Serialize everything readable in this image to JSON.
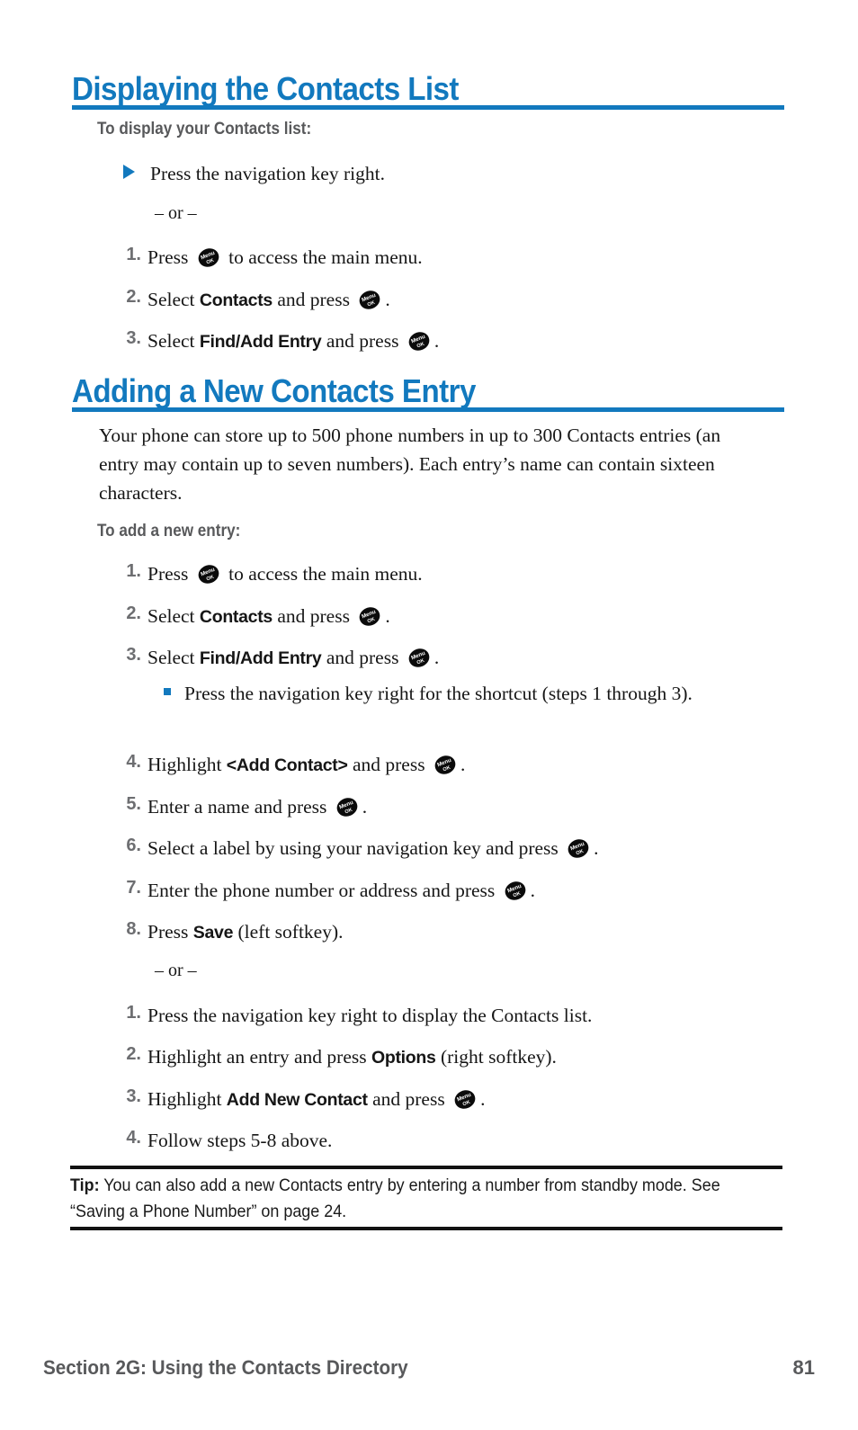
{
  "page": {
    "number": "81",
    "footer_section": "Section 2G: Using the Contacts Directory",
    "accent_color": "#1279be",
    "heading_rule_color": "#1279be",
    "subhead_color": "#58595b"
  },
  "sections": [
    {
      "id": "displaying",
      "heading": "Displaying the Contacts List",
      "subhead": "To display your Contacts list:",
      "bullet": "Press the navigation key right.",
      "or_divider": "– or –",
      "steps": [
        {
          "num": "1.",
          "pre": "Press ",
          "icon": "menu-ok-key-icon",
          "post": " to access the main menu.",
          "bold": ""
        },
        {
          "num": "2.",
          "pre": "Select ",
          "bold": "Contacts",
          "mid": " and press ",
          "icon": "menu-ok-key-icon",
          "post": "."
        },
        {
          "num": "3.",
          "pre": "Select ",
          "bold": "Find/Add Entry",
          "mid": " and press ",
          "icon": "menu-ok-key-icon",
          "post": "."
        }
      ]
    },
    {
      "id": "adding",
      "heading": "Adding a New Contacts Entry",
      "paragraph": "Your phone can store up to 500 phone numbers in up to 300 Contacts entries (an entry may contain up to seven numbers). Each entry’s name can contain sixteen characters.",
      "subhead": "To add a new entry:",
      "steps": [
        {
          "num": "1.",
          "pre": "Press ",
          "icon": "menu-ok-key-icon",
          "post": " to access the main menu."
        },
        {
          "num": "2.",
          "pre": "Select ",
          "bold": "Contacts",
          "mid": " and press ",
          "icon": "menu-ok-key-icon",
          "post": "."
        },
        {
          "num": "3.",
          "pre": "Select ",
          "bold": "Find/Add Entry",
          "mid": " and press ",
          "icon": "menu-ok-key-icon",
          "post": "."
        }
      ],
      "sub_bullet": "Press the navigation key right for the shortcut (steps 1 through 3).",
      "steps_cont": [
        {
          "num": "4.",
          "pre": "Highlight ",
          "bold": "<Add Contact>",
          "mid": " and press ",
          "icon": "menu-ok-key-icon",
          "post": "."
        },
        {
          "num": "5.",
          "pre": "Enter a name and press ",
          "icon": "menu-ok-key-icon",
          "post": "."
        },
        {
          "num": "6.",
          "pre": "Select a label by using your navigation key and press ",
          "icon": "menu-ok-key-icon",
          "post": "."
        },
        {
          "num": "7.",
          "pre": "Enter the phone number or address and press ",
          "icon": "menu-ok-key-icon",
          "post": "."
        },
        {
          "num": "8.",
          "pre": "Press ",
          "bold": "Save",
          "mid": " (left softkey).",
          "post": ""
        }
      ],
      "or_divider": "– or –",
      "steps_alt": [
        {
          "num": "1.",
          "pre": "Press the navigation key right to display the Contacts list."
        },
        {
          "num": "2.",
          "pre": "Highlight an entry and press ",
          "bold": "Options",
          "mid": " (right softkey)."
        },
        {
          "num": "3.",
          "pre": "Highlight ",
          "bold": "Add New Contact",
          "mid": " and press ",
          "icon": "menu-ok-key-icon",
          "post": "."
        },
        {
          "num": "4.",
          "pre": "Follow steps 5-8 above."
        }
      ]
    }
  ],
  "tip": {
    "label": "Tip:",
    "text": " You can also add a new Contacts entry by entering a number from standby mode. See “Saving a Phone Number” on page 24."
  },
  "icons": {
    "menu_ok_key": {
      "line1": "Menu",
      "line2": "OK"
    }
  }
}
